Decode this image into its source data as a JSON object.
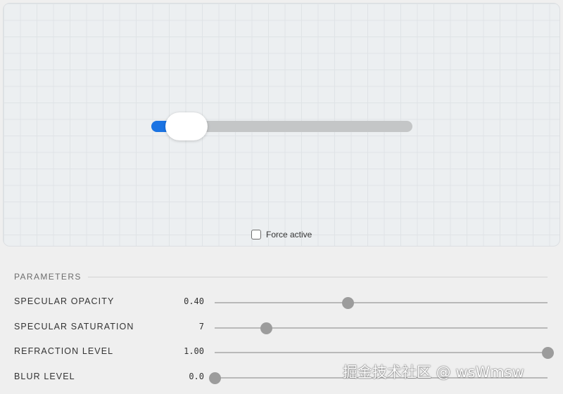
{
  "preview": {
    "demo_slider": {
      "value_fraction": 0.05,
      "accent_color": "#1a73e3"
    },
    "force_active": {
      "label": "Force active",
      "checked": false
    }
  },
  "parameters": {
    "title": "PARAMETERS",
    "rows": [
      {
        "label": "SPECULAR OPACITY",
        "value": "0.40",
        "fraction": 0.4
      },
      {
        "label": "SPECULAR SATURATION",
        "value": "7",
        "fraction": 0.155
      },
      {
        "label": "REFRACTION LEVEL",
        "value": "1.00",
        "fraction": 1.0
      },
      {
        "label": "BLUR LEVEL",
        "value": "0.0",
        "fraction": 0.0
      }
    ]
  },
  "watermark": "掘金技术社区 @ wsWmsw"
}
